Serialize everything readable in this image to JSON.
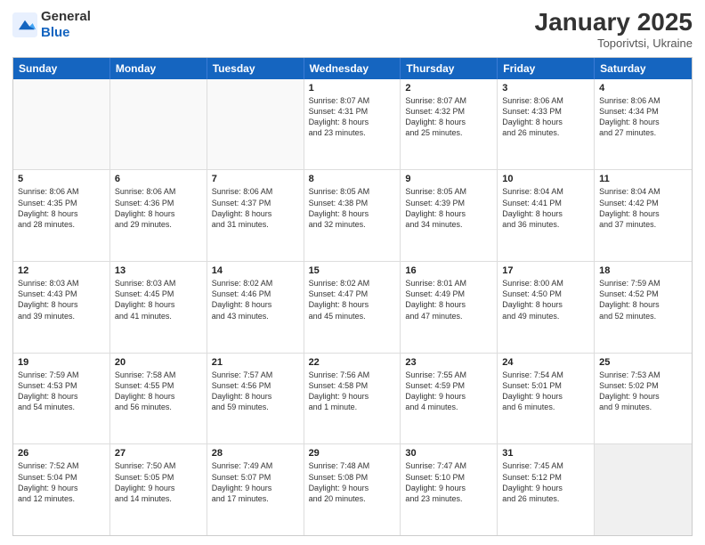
{
  "logo": {
    "general": "General",
    "blue": "Blue"
  },
  "header": {
    "month": "January 2025",
    "location": "Toporivtsi, Ukraine"
  },
  "weekdays": [
    "Sunday",
    "Monday",
    "Tuesday",
    "Wednesday",
    "Thursday",
    "Friday",
    "Saturday"
  ],
  "rows": [
    [
      {
        "day": "",
        "text": "",
        "empty": true
      },
      {
        "day": "",
        "text": "",
        "empty": true
      },
      {
        "day": "",
        "text": "",
        "empty": true
      },
      {
        "day": "1",
        "text": "Sunrise: 8:07 AM\nSunset: 4:31 PM\nDaylight: 8 hours\nand 23 minutes."
      },
      {
        "day": "2",
        "text": "Sunrise: 8:07 AM\nSunset: 4:32 PM\nDaylight: 8 hours\nand 25 minutes."
      },
      {
        "day": "3",
        "text": "Sunrise: 8:06 AM\nSunset: 4:33 PM\nDaylight: 8 hours\nand 26 minutes."
      },
      {
        "day": "4",
        "text": "Sunrise: 8:06 AM\nSunset: 4:34 PM\nDaylight: 8 hours\nand 27 minutes."
      }
    ],
    [
      {
        "day": "5",
        "text": "Sunrise: 8:06 AM\nSunset: 4:35 PM\nDaylight: 8 hours\nand 28 minutes."
      },
      {
        "day": "6",
        "text": "Sunrise: 8:06 AM\nSunset: 4:36 PM\nDaylight: 8 hours\nand 29 minutes."
      },
      {
        "day": "7",
        "text": "Sunrise: 8:06 AM\nSunset: 4:37 PM\nDaylight: 8 hours\nand 31 minutes."
      },
      {
        "day": "8",
        "text": "Sunrise: 8:05 AM\nSunset: 4:38 PM\nDaylight: 8 hours\nand 32 minutes."
      },
      {
        "day": "9",
        "text": "Sunrise: 8:05 AM\nSunset: 4:39 PM\nDaylight: 8 hours\nand 34 minutes."
      },
      {
        "day": "10",
        "text": "Sunrise: 8:04 AM\nSunset: 4:41 PM\nDaylight: 8 hours\nand 36 minutes."
      },
      {
        "day": "11",
        "text": "Sunrise: 8:04 AM\nSunset: 4:42 PM\nDaylight: 8 hours\nand 37 minutes."
      }
    ],
    [
      {
        "day": "12",
        "text": "Sunrise: 8:03 AM\nSunset: 4:43 PM\nDaylight: 8 hours\nand 39 minutes."
      },
      {
        "day": "13",
        "text": "Sunrise: 8:03 AM\nSunset: 4:45 PM\nDaylight: 8 hours\nand 41 minutes."
      },
      {
        "day": "14",
        "text": "Sunrise: 8:02 AM\nSunset: 4:46 PM\nDaylight: 8 hours\nand 43 minutes."
      },
      {
        "day": "15",
        "text": "Sunrise: 8:02 AM\nSunset: 4:47 PM\nDaylight: 8 hours\nand 45 minutes."
      },
      {
        "day": "16",
        "text": "Sunrise: 8:01 AM\nSunset: 4:49 PM\nDaylight: 8 hours\nand 47 minutes."
      },
      {
        "day": "17",
        "text": "Sunrise: 8:00 AM\nSunset: 4:50 PM\nDaylight: 8 hours\nand 49 minutes."
      },
      {
        "day": "18",
        "text": "Sunrise: 7:59 AM\nSunset: 4:52 PM\nDaylight: 8 hours\nand 52 minutes."
      }
    ],
    [
      {
        "day": "19",
        "text": "Sunrise: 7:59 AM\nSunset: 4:53 PM\nDaylight: 8 hours\nand 54 minutes."
      },
      {
        "day": "20",
        "text": "Sunrise: 7:58 AM\nSunset: 4:55 PM\nDaylight: 8 hours\nand 56 minutes."
      },
      {
        "day": "21",
        "text": "Sunrise: 7:57 AM\nSunset: 4:56 PM\nDaylight: 8 hours\nand 59 minutes."
      },
      {
        "day": "22",
        "text": "Sunrise: 7:56 AM\nSunset: 4:58 PM\nDaylight: 9 hours\nand 1 minute."
      },
      {
        "day": "23",
        "text": "Sunrise: 7:55 AM\nSunset: 4:59 PM\nDaylight: 9 hours\nand 4 minutes."
      },
      {
        "day": "24",
        "text": "Sunrise: 7:54 AM\nSunset: 5:01 PM\nDaylight: 9 hours\nand 6 minutes."
      },
      {
        "day": "25",
        "text": "Sunrise: 7:53 AM\nSunset: 5:02 PM\nDaylight: 9 hours\nand 9 minutes."
      }
    ],
    [
      {
        "day": "26",
        "text": "Sunrise: 7:52 AM\nSunset: 5:04 PM\nDaylight: 9 hours\nand 12 minutes."
      },
      {
        "day": "27",
        "text": "Sunrise: 7:50 AM\nSunset: 5:05 PM\nDaylight: 9 hours\nand 14 minutes."
      },
      {
        "day": "28",
        "text": "Sunrise: 7:49 AM\nSunset: 5:07 PM\nDaylight: 9 hours\nand 17 minutes."
      },
      {
        "day": "29",
        "text": "Sunrise: 7:48 AM\nSunset: 5:08 PM\nDaylight: 9 hours\nand 20 minutes."
      },
      {
        "day": "30",
        "text": "Sunrise: 7:47 AM\nSunset: 5:10 PM\nDaylight: 9 hours\nand 23 minutes."
      },
      {
        "day": "31",
        "text": "Sunrise: 7:45 AM\nSunset: 5:12 PM\nDaylight: 9 hours\nand 26 minutes."
      },
      {
        "day": "",
        "text": "",
        "empty": true,
        "shaded": true
      }
    ]
  ]
}
